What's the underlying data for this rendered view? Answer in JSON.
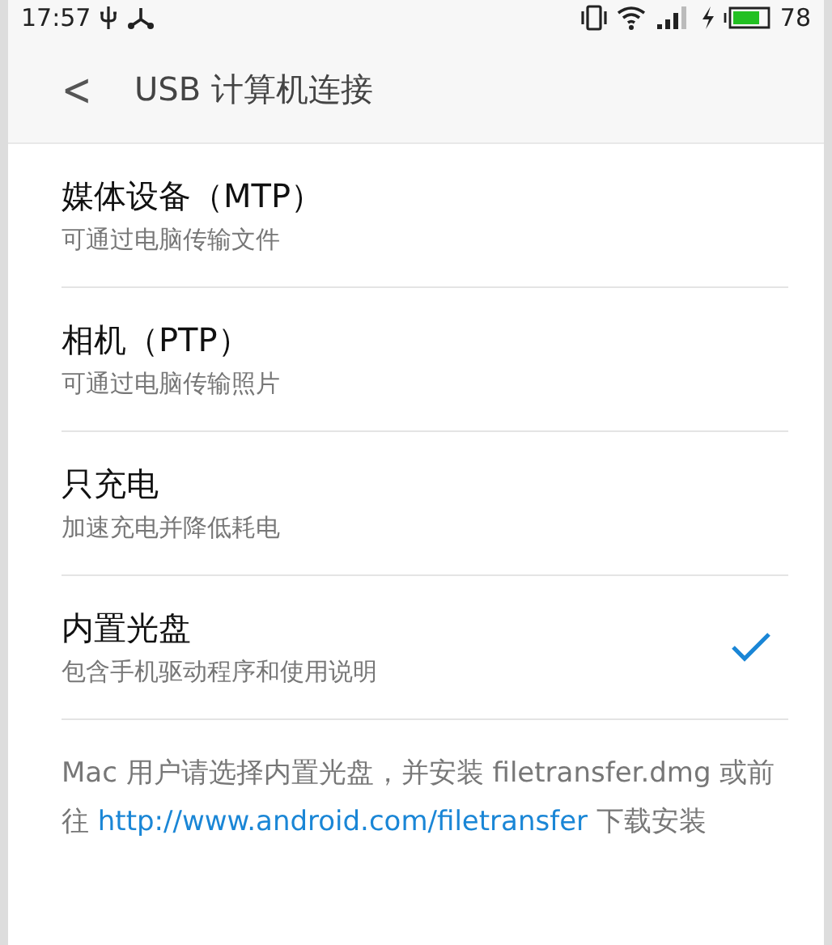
{
  "status_bar": {
    "time": "17:57",
    "battery": "78"
  },
  "header": {
    "back": "<",
    "title": "USB 计算机连接"
  },
  "options": [
    {
      "title": "媒体设备（MTP）",
      "subtitle": "可通过电脑传输文件",
      "selected": false
    },
    {
      "title": "相机（PTP）",
      "subtitle": "可通过电脑传输照片",
      "selected": false
    },
    {
      "title": "只充电",
      "subtitle": "加速充电并降低耗电",
      "selected": false
    },
    {
      "title": "内置光盘",
      "subtitle": "包含手机驱动程序和使用说明",
      "selected": true
    }
  ],
  "note": {
    "text_before": "Mac 用户请选择内置光盘，并安装 filetransfer.dmg 或前往",
    "link": "http://www.android.com/filetransfer",
    "text_after": "下载安装"
  }
}
